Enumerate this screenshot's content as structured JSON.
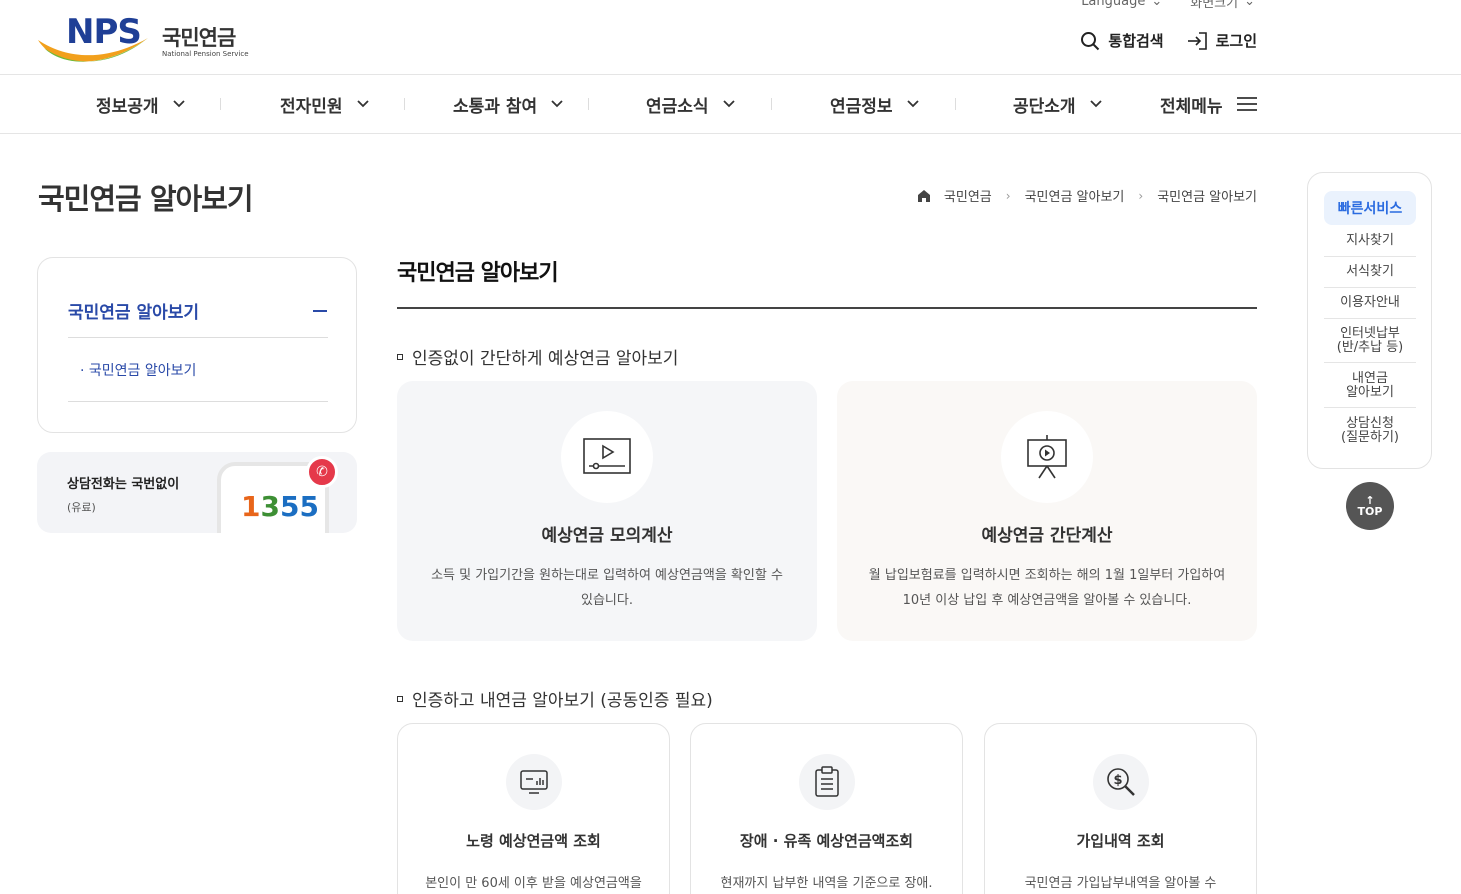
{
  "header": {
    "brand_en": "NPS",
    "brand_kr": "국민연금",
    "brand_sub": "National Pension Service",
    "language_label": "Language",
    "fontsize_label": "화면크기",
    "search_label": "통합검색",
    "login_label": "로그인"
  },
  "gnb": [
    {
      "label": "정보공개"
    },
    {
      "label": "전자민원"
    },
    {
      "label": "소통과 참여"
    },
    {
      "label": "연금소식"
    },
    {
      "label": "연금정보"
    },
    {
      "label": "공단소개"
    },
    {
      "label": "전체메뉴"
    }
  ],
  "page": {
    "title": "국민연금 알아보기",
    "breadcrumb": [
      "국민연금",
      "국민연금 알아보기",
      "국민연금 알아보기"
    ]
  },
  "side": {
    "head": "국민연금 알아보기",
    "sub_item": "· 국민연금 알아보기",
    "call_label": "상담전화는 국번없이",
    "call_sub": "(유료)",
    "call_number": [
      "1",
      "3",
      "5",
      "5"
    ]
  },
  "content": {
    "title": "국민연금 알아보기",
    "section1": "인증없이 간단하게 예상연금 알아보기",
    "section2": "인증하고 내연금 알아보기 (공동인증 필요)",
    "big_cards": [
      {
        "title": "예상연금 모의계산",
        "desc": "소득 및 가입기간을 원하는대로 입력하여 예상연금액을 확인할 수 있습니다.",
        "icon": "video-screen-icon",
        "bg": "#f5f6f8"
      },
      {
        "title": "예상연금 간단계산",
        "desc": "월 납입보험료를 입력하시면 조회하는 해의 1월 1일부터 가입하여 10년 이상 납입 후 예상연금액을 알아볼 수 있습니다.",
        "icon": "presentation-icon",
        "bg": "#faf8f6"
      }
    ],
    "small_cards": [
      {
        "title": "노령 예상연금액 조회",
        "desc": "본인이 만 60세 이후 받을 예상연금액을",
        "icon": "monitor-chart-icon"
      },
      {
        "title": "장애 · 유족 예상연금액조회",
        "desc": "현재까지 납부한 내역을 기준으로 장애.",
        "icon": "clipboard-icon"
      },
      {
        "title": "가입내역 조회",
        "desc": "국민연금 가입납부내역을 알아볼 수",
        "icon": "money-search-icon"
      }
    ]
  },
  "quick": {
    "head": "빠른서비스",
    "items": [
      "지사찾기",
      "서식찾기",
      "이용자안내",
      "인터넷납부\n(반/추납 등)",
      "내연금\n알아보기",
      "상담신청\n(질문하기)"
    ],
    "top_label": "TOP"
  }
}
